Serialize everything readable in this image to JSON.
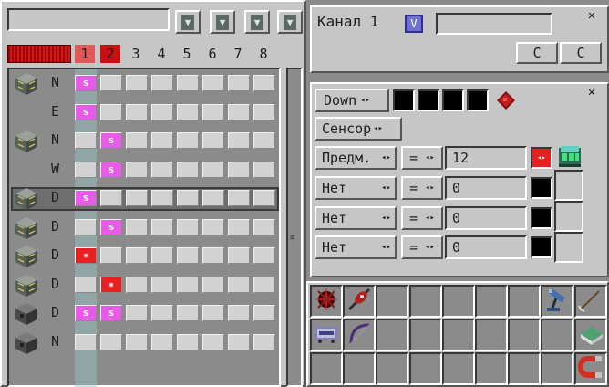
{
  "left": {
    "tabs": [
      "1",
      "2",
      "3",
      "4",
      "5",
      "6",
      "7",
      "8"
    ],
    "active_tab": "1",
    "rows": [
      {
        "dir": "N",
        "marks": [
          {
            "col": 0,
            "type": "s"
          }
        ]
      },
      {
        "dir": "E",
        "marks": [
          {
            "col": 0,
            "type": "s"
          }
        ]
      },
      {
        "dir": "N",
        "marks": [
          {
            "col": 1,
            "type": "s"
          }
        ]
      },
      {
        "dir": "W",
        "marks": [
          {
            "col": 1,
            "type": "s"
          }
        ]
      },
      {
        "dir": "D",
        "marks": [
          {
            "col": 0,
            "type": "s"
          }
        ]
      },
      {
        "dir": "D",
        "marks": [
          {
            "col": 1,
            "type": "s"
          }
        ]
      },
      {
        "dir": "D",
        "marks": [
          {
            "col": 0,
            "type": "star"
          }
        ]
      },
      {
        "dir": "D",
        "marks": [
          {
            "col": 1,
            "type": "star"
          }
        ]
      },
      {
        "dir": "D",
        "marks": [
          {
            "col": 0,
            "type": "s"
          },
          {
            "col": 1,
            "type": "s"
          }
        ]
      },
      {
        "dir": "N",
        "marks": []
      }
    ],
    "mark_s": "s",
    "mark_star": "✷"
  },
  "channel": {
    "label": "Канал 1",
    "check_glyph": "V",
    "btn1": "С",
    "btn2": "С",
    "close": "✕"
  },
  "filter": {
    "close": "✕",
    "down_label": "Down",
    "sensor_label": "Сенсор",
    "arrows": "◂▸",
    "rows": [
      {
        "type": "Предм.",
        "op": "=",
        "value": "12"
      },
      {
        "type": "Нет",
        "op": "=",
        "value": "0"
      },
      {
        "type": "Нет",
        "op": "=",
        "value": "0"
      },
      {
        "type": "Нет",
        "op": "=",
        "value": "0"
      }
    ]
  },
  "inventory": {
    "icons": [
      "firework-star-icon",
      "cluster-item-icon",
      "telescope-icon",
      "arrow-icon",
      "minecart-icon",
      "bow-icon",
      "book-icon",
      "magnet-icon"
    ]
  },
  "colors": {
    "pink": "#e85ae8",
    "red": "#e82020",
    "accent": "#4040c0"
  }
}
